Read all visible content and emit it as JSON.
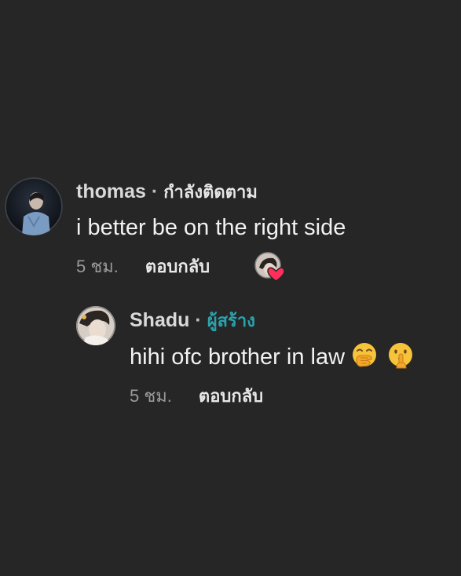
{
  "comment": {
    "username": "thomas",
    "separator": "·",
    "follow_status": "กำลังติดตาม",
    "text": "i better be on the right side",
    "time": "5 ชม.",
    "reply_label": "ตอบกลับ",
    "avatar_icon": "profile-photo-icon",
    "liked_by_creator_icon": "creator-heart-like-icon"
  },
  "reply": {
    "username": "Shadu",
    "separator": "·",
    "author_badge": "ผู้สร้าง",
    "text": "hihi ofc brother in law",
    "emojis": [
      "face-with-hand-over-mouth-icon",
      "shushing-face-icon"
    ],
    "time": "5 ชม.",
    "reply_label": "ตอบกลับ",
    "avatar_icon": "profile-photo-icon"
  },
  "colors": {
    "background": "#262626",
    "author_badge": "#2aa3ad",
    "heart": "#ff2f5b"
  }
}
